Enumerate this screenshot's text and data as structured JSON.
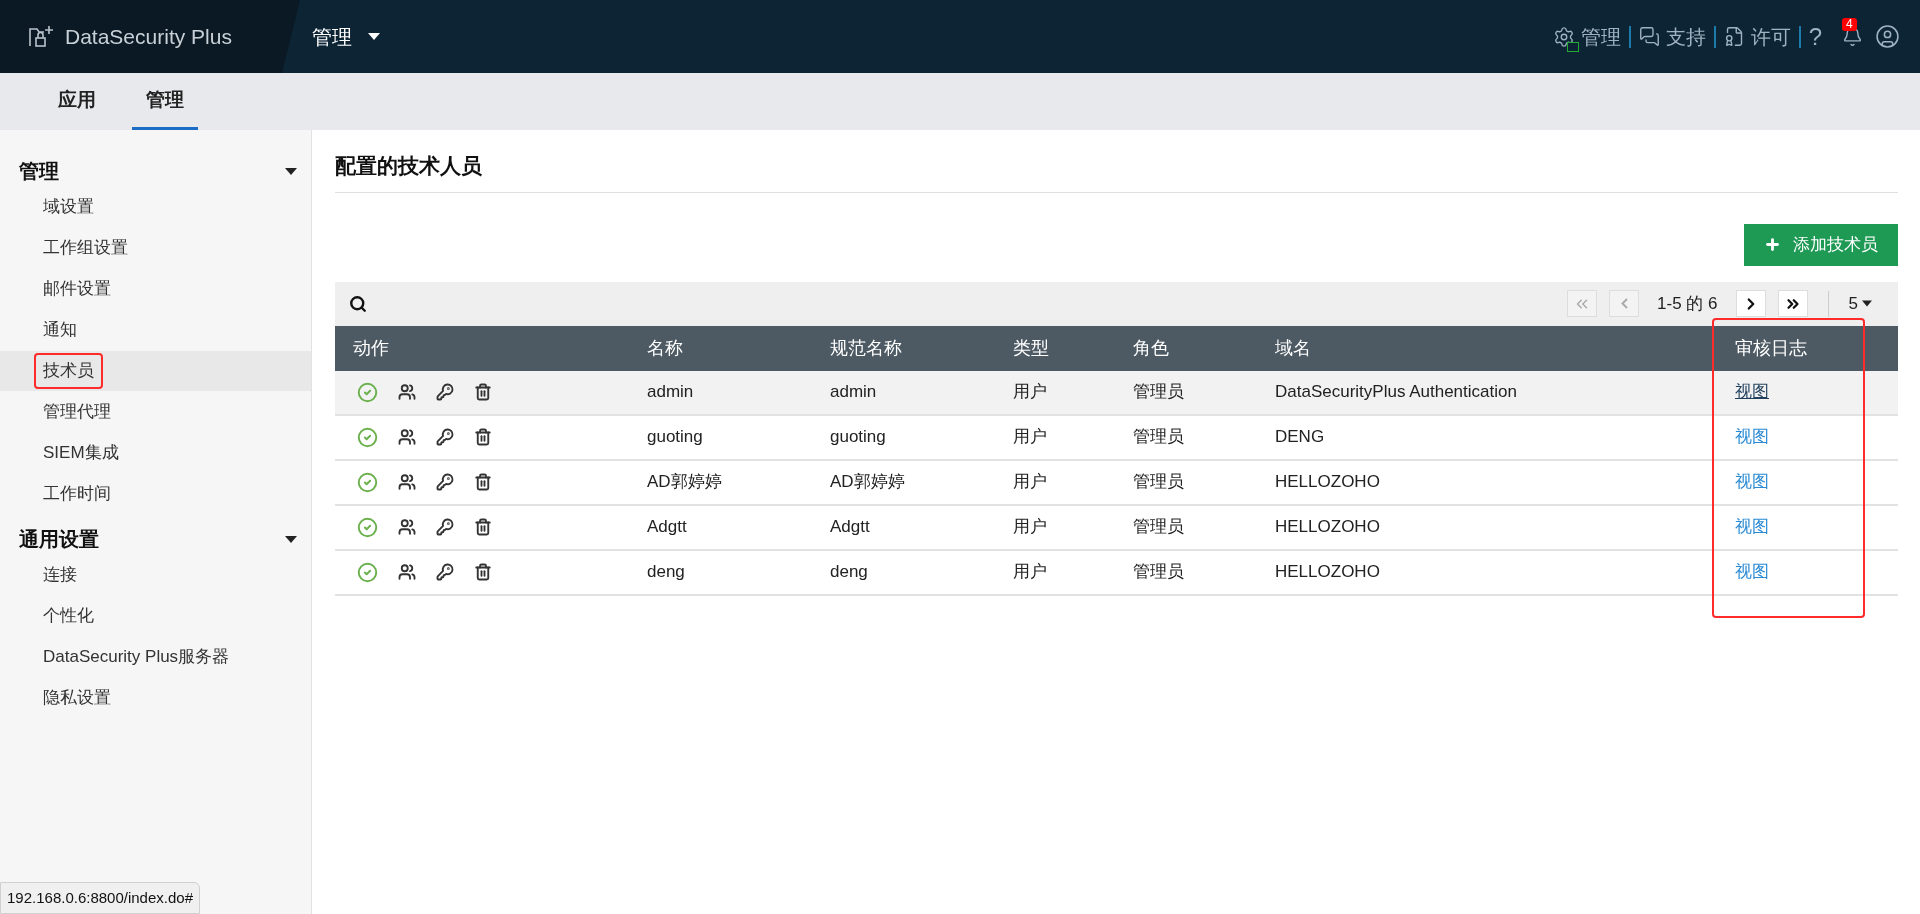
{
  "header": {
    "product": "DataSecurity Plus",
    "module_menu": "管理",
    "actions": [
      {
        "kind": "admin",
        "label": "管理"
      },
      {
        "kind": "support",
        "label": "支持"
      },
      {
        "kind": "license",
        "label": "许可"
      },
      {
        "kind": "help",
        "label": "?"
      }
    ],
    "notification_count": "4"
  },
  "tabs": [
    {
      "label": "应用",
      "selected": false
    },
    {
      "label": "管理",
      "selected": true
    }
  ],
  "sidebar": [
    {
      "title": "管理",
      "expanded": true,
      "items": [
        {
          "label": "域设置",
          "selected": false,
          "annotated": false
        },
        {
          "label": "工作组设置",
          "selected": false,
          "annotated": false
        },
        {
          "label": "邮件设置",
          "selected": false,
          "annotated": false
        },
        {
          "label": "通知",
          "selected": false,
          "annotated": false
        },
        {
          "label": "技术员",
          "selected": true,
          "annotated": true
        },
        {
          "label": "管理代理",
          "selected": false,
          "annotated": false
        },
        {
          "label": "SIEM集成",
          "selected": false,
          "annotated": false
        },
        {
          "label": "工作时间",
          "selected": false,
          "annotated": false
        }
      ]
    },
    {
      "title": "通用设置",
      "expanded": true,
      "items": [
        {
          "label": "连接",
          "selected": false,
          "annotated": false
        },
        {
          "label": "个性化",
          "selected": false,
          "annotated": false
        },
        {
          "label": "DataSecurity Plus服务器",
          "selected": false,
          "annotated": false
        },
        {
          "label": "隐私设置",
          "selected": false,
          "annotated": false
        }
      ]
    }
  ],
  "page_title": "配置的技术人员",
  "add_button": "添加技术员",
  "pagination": {
    "range": "1-5 的 6",
    "page_size": "5"
  },
  "table": {
    "columns": [
      {
        "label": "动作",
        "annotated": false
      },
      {
        "label": "名称",
        "annotated": false
      },
      {
        "label": "规范名称",
        "annotated": false
      },
      {
        "label": "类型",
        "annotated": false
      },
      {
        "label": "角色",
        "annotated": false
      },
      {
        "label": "域名",
        "annotated": false
      },
      {
        "label": "审核日志",
        "annotated": true
      }
    ],
    "rows": [
      {
        "enabled": true,
        "name": "admin",
        "canonical": "admin",
        "type": "用户",
        "role": "管理员",
        "domain": "DataSecurityPlus Authentication",
        "audit": "视图",
        "hovered": true
      },
      {
        "enabled": true,
        "name": "guoting",
        "canonical": "guoting",
        "type": "用户",
        "role": "管理员",
        "domain": "DENG",
        "audit": "视图",
        "hovered": false
      },
      {
        "enabled": true,
        "name": "AD郭婷婷",
        "canonical": "AD郭婷婷",
        "type": "用户",
        "role": "管理员",
        "domain": "HELLOZOHO",
        "audit": "视图",
        "hovered": false
      },
      {
        "enabled": true,
        "name": "Adgtt",
        "canonical": "Adgtt",
        "type": "用户",
        "role": "管理员",
        "domain": "HELLOZOHO",
        "audit": "视图",
        "hovered": false
      },
      {
        "enabled": true,
        "name": "deng",
        "canonical": "deng",
        "type": "用户",
        "role": "管理员",
        "domain": "HELLOZOHO",
        "audit": "视图",
        "hovered": false
      }
    ]
  },
  "status_url": "192.168.0.6:8800/index.do#"
}
